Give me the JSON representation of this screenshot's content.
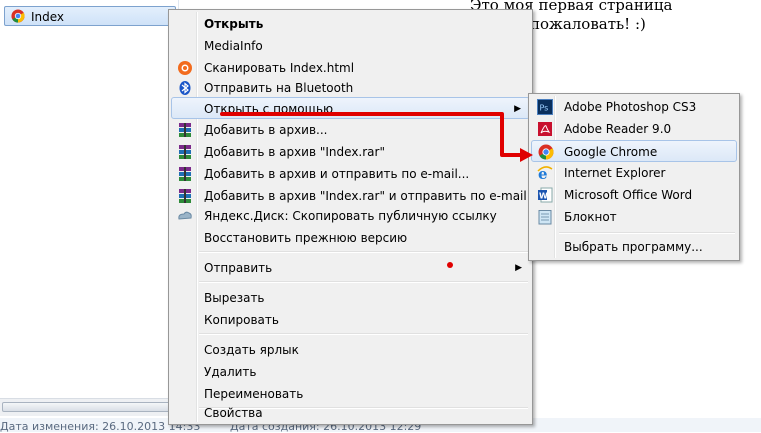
{
  "file": {
    "name": "Index",
    "icon": "chrome-icon"
  },
  "document": {
    "line1": "Это моя первая страница",
    "line2": "пожаловать! :)"
  },
  "status": {
    "modified": "Дата изменения: 26.10.2013 14:33",
    "created": "Дата создания: 26.10.2013 12:29"
  },
  "context_menu": {
    "items": [
      {
        "label": "Открыть",
        "bold": true
      },
      {
        "label": "MediaInfo"
      },
      {
        "label": "Сканировать Index.html",
        "icon": "avast-icon"
      },
      {
        "label": "Отправить на Bluetooth",
        "icon": "bluetooth-icon"
      },
      {
        "label": "Открыть с помощью",
        "submenu": true
      },
      {
        "label": "Добавить в архив...",
        "icon": "winrar-icon"
      },
      {
        "label": "Добавить в архив \"Index.rar\"",
        "icon": "winrar-icon"
      },
      {
        "label": "Добавить в архив и отправить по e-mail...",
        "icon": "winrar-icon"
      },
      {
        "label": "Добавить в архив \"Index.rar\" и отправить по e-mail",
        "icon": "winrar-icon"
      },
      {
        "label": "Яндекс.Диск: Скопировать публичную ссылку",
        "icon": "yandex-disk-icon"
      },
      {
        "label": "Восстановить прежнюю версию"
      },
      {
        "label": "Отправить",
        "submenu": true
      },
      {
        "label": "Вырезать"
      },
      {
        "label": "Копировать"
      },
      {
        "label": "Создать ярлык"
      },
      {
        "label": "Удалить"
      },
      {
        "label": "Переименовать"
      },
      {
        "label": "Свойства"
      }
    ]
  },
  "open_with_menu": {
    "items": [
      {
        "label": "Adobe Photoshop CS3",
        "icon": "photoshop-icon"
      },
      {
        "label": "Adobe Reader 9.0",
        "icon": "adobe-reader-icon"
      },
      {
        "label": "Google Chrome",
        "icon": "chrome-icon"
      },
      {
        "label": "Internet Explorer",
        "icon": "ie-icon"
      },
      {
        "label": "Microsoft Office Word",
        "icon": "word-icon"
      },
      {
        "label": "Блокнот",
        "icon": "notepad-icon"
      },
      {
        "label": "Выбрать программу..."
      }
    ]
  },
  "colors": {
    "annotation": "#e00000",
    "hover_border": "#a8c4e8",
    "menu_bg": "#f0f0f0"
  }
}
